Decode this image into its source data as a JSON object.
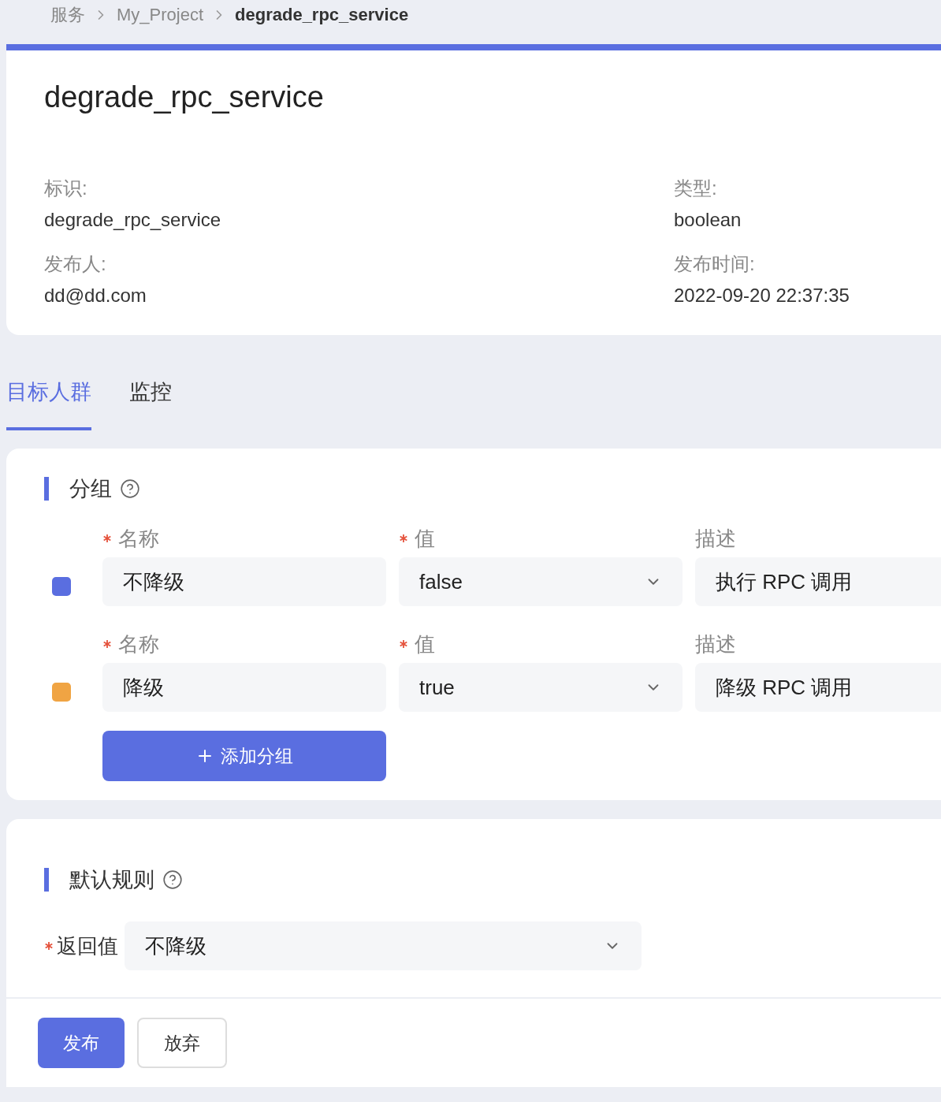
{
  "breadcrumb": [
    {
      "label": "服务",
      "current": false
    },
    {
      "label": "My_Project",
      "current": false
    },
    {
      "label": "degrade_rpc_service",
      "current": true
    }
  ],
  "header": {
    "title": "degrade_rpc_service",
    "fields": [
      {
        "label": "标识:",
        "value": "degrade_rpc_service"
      },
      {
        "label": "类型:",
        "value": "boolean"
      },
      {
        "label": "发布人:",
        "value": "dd@dd.com"
      },
      {
        "label": "发布时间:",
        "value": "2022-09-20 22:37:35"
      }
    ]
  },
  "tabs": [
    {
      "label": "目标人群",
      "selected": true
    },
    {
      "label": "监控",
      "selected": false
    }
  ],
  "groups_section": {
    "title": "分组",
    "groups": [
      {
        "color": "#5a6ee0",
        "name_label": "名称",
        "name": "不降级",
        "value_label": "值",
        "value": "false",
        "desc_label": "描述",
        "desc": "执行 RPC 调用"
      },
      {
        "color": "#f0a443",
        "name_label": "名称",
        "name": "降级",
        "value_label": "值",
        "value": "true",
        "desc_label": "描述",
        "desc": "降级 RPC 调用"
      }
    ],
    "add_button": "添加分组"
  },
  "default_rule": {
    "title": "默认规则",
    "field_label": "返回值",
    "value": "不降级"
  },
  "actions": [
    {
      "label": "发布",
      "kind": "primary"
    },
    {
      "label": "放弃",
      "kind": "secondary"
    }
  ]
}
